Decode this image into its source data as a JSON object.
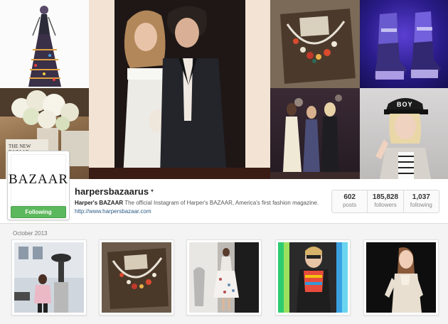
{
  "mosaic": {
    "tiles": [
      {
        "icon": "fashion-sketch-photo"
      },
      {
        "icon": "flowers-magazine-photo",
        "magazine_caption": "THE NEW BAZAAR"
      },
      {
        "icon": "couple-photo"
      },
      {
        "icon": "necklace-photo"
      },
      {
        "icon": "platform-boots-photo"
      },
      {
        "icon": "party-women-photo"
      },
      {
        "icon": "girl-cap-photo",
        "cap_text": "BOY"
      }
    ]
  },
  "profile": {
    "avatar_logo": "BAZAAR",
    "follow_label": "Following",
    "username": "harpersbazaarus",
    "caret": "▾",
    "bio_name": "Harper's BAZAAR",
    "bio_text": " The official Instagram of Harper's BAZAAR, America's first fashion magazine. ",
    "bio_link": "http://www.harpersbazaar.com"
  },
  "stats": [
    {
      "value": "602",
      "label": "posts"
    },
    {
      "value": "185,828",
      "label": "followers"
    },
    {
      "value": "1,037",
      "label": "following"
    }
  ],
  "feed": {
    "month_label": "October 2013",
    "thumbs": [
      {
        "icon": "woman-pink-coat-photo"
      },
      {
        "icon": "necklace-photo"
      },
      {
        "icon": "white-dress-photo"
      },
      {
        "icon": "woman-colorful-shirt-photo"
      },
      {
        "icon": "woman-dark-background-photo"
      }
    ]
  },
  "colors": {
    "follow_green": "#5cb85c",
    "link_blue": "#2b5a84",
    "page_bg": "#f4f4f4"
  }
}
